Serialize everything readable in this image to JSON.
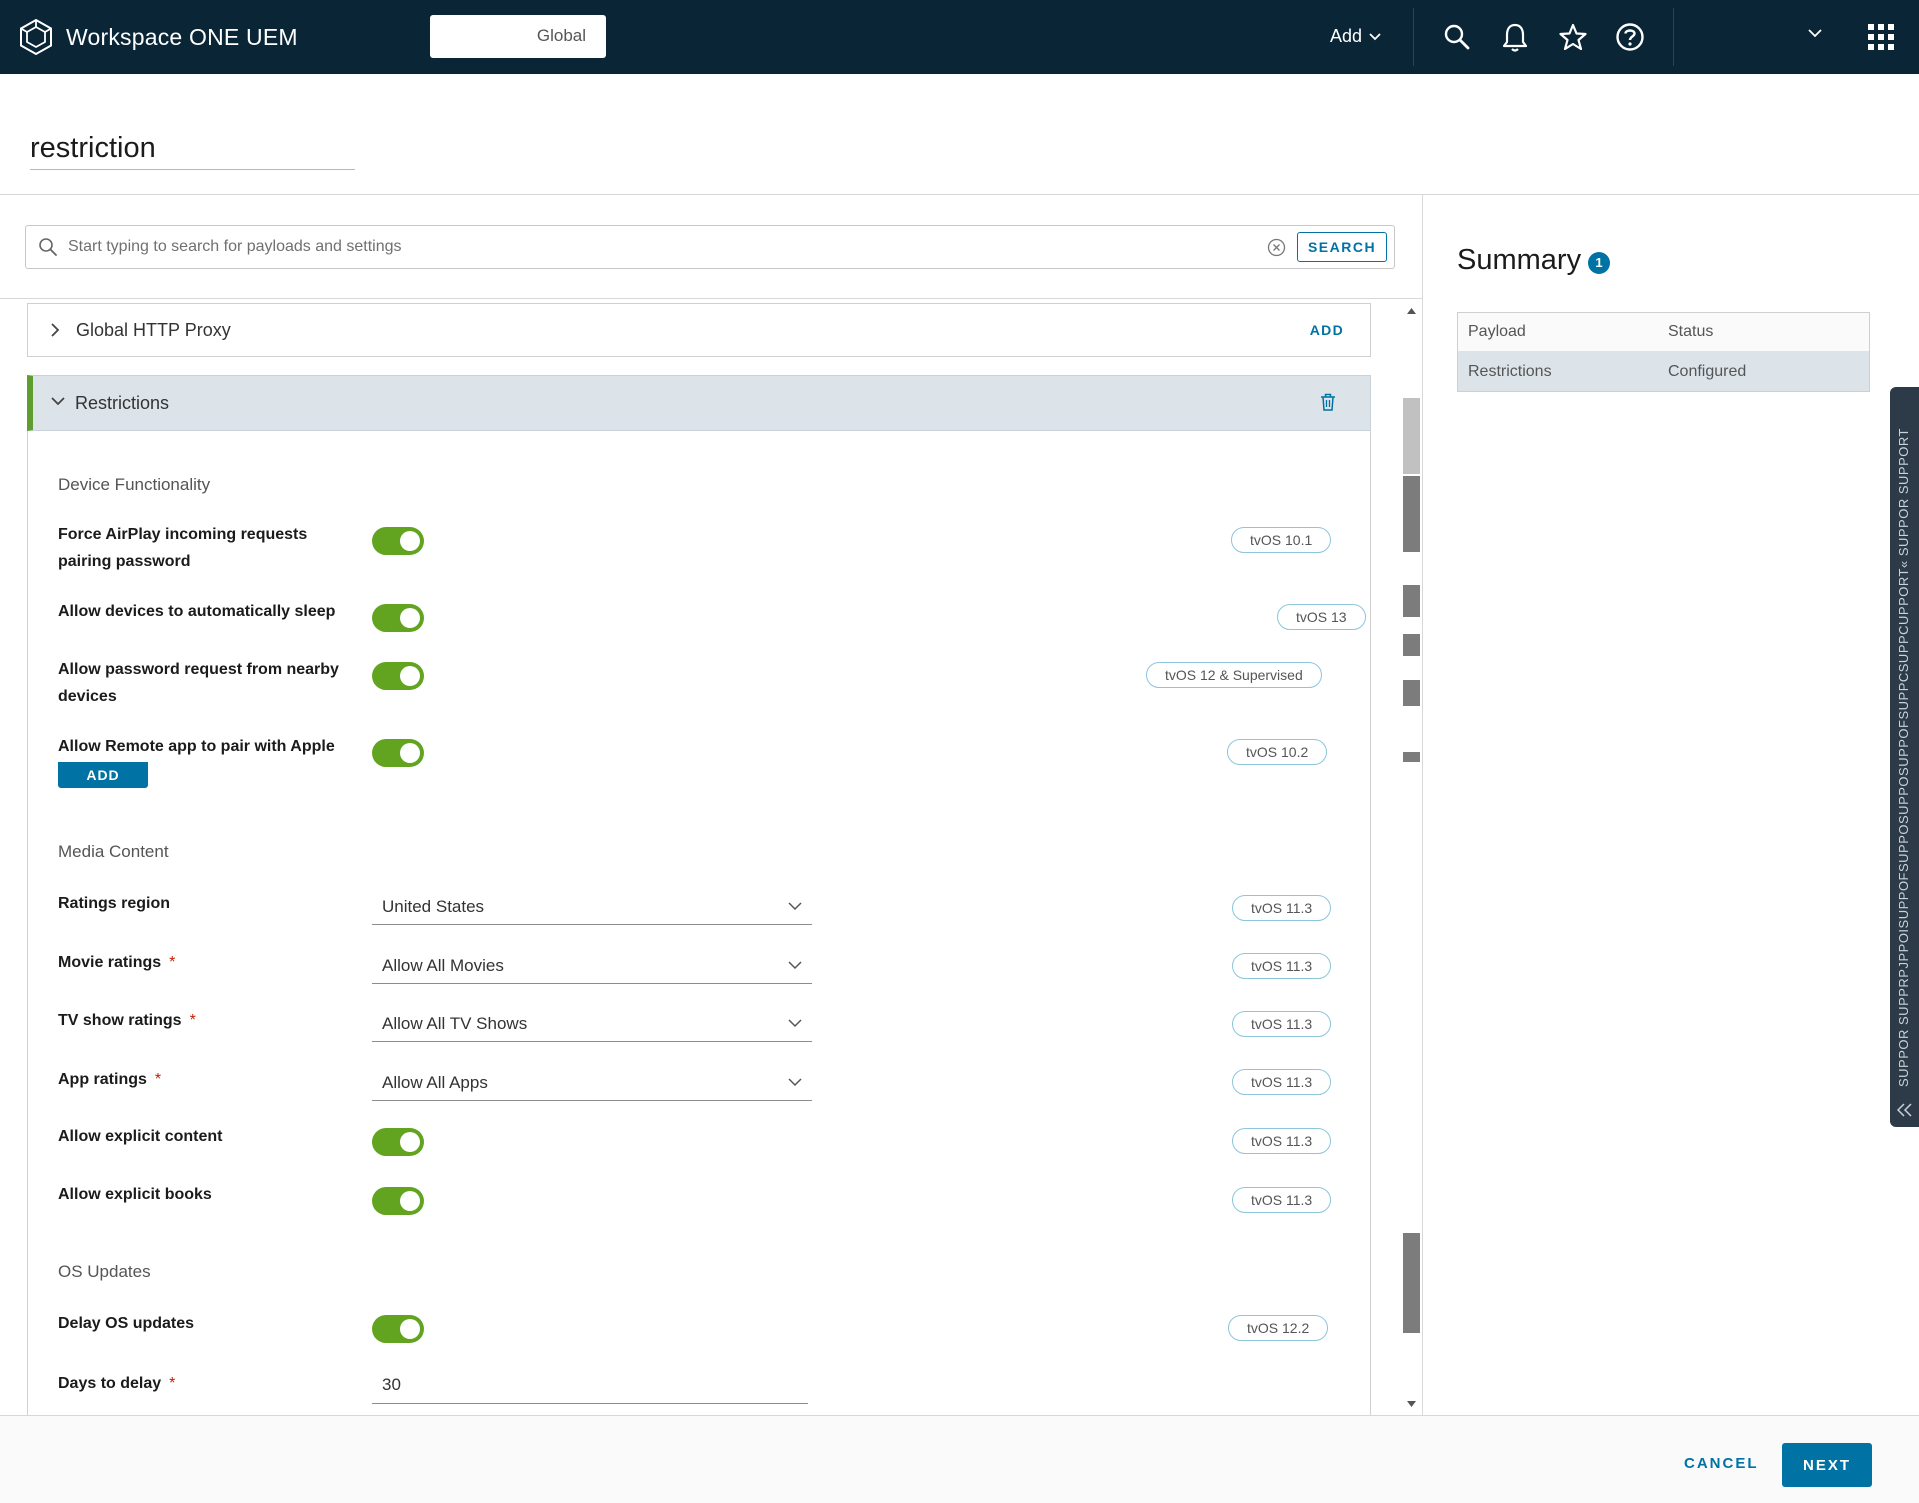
{
  "header": {
    "app_name": "Workspace ONE UEM",
    "org_group": "Global",
    "add_label": "Add",
    "icons": [
      "search-icon",
      "bell-icon",
      "star-icon",
      "help-icon",
      "chevron-down-icon",
      "app-grid-icon"
    ]
  },
  "page": {
    "title": "restriction"
  },
  "search": {
    "placeholder": "Start typing to search for payloads and settings",
    "button_label": "SEARCH"
  },
  "payloads": {
    "proxy": {
      "label": "Global HTTP Proxy",
      "action": "ADD"
    },
    "restrictions": {
      "label": "Restrictions"
    }
  },
  "sections": {
    "device": "Device Functionality",
    "media": "Media Content",
    "os": "OS Updates"
  },
  "fields": {
    "airplay": {
      "label": "Force AirPlay incoming requests pairing password",
      "badge": "tvOS 10.1",
      "on": true
    },
    "sleep": {
      "label": "Allow devices to automatically sleep",
      "badge": "tvOS 13",
      "on": true
    },
    "password": {
      "label": "Allow password request from nearby devices",
      "badge": "tvOS 12 & Supervised",
      "on": true
    },
    "remote": {
      "label": "Allow Remote app to pair with Apple",
      "badge": "tvOS 10.2",
      "on": true,
      "overlay_button": "ADD"
    },
    "ratings_region": {
      "label": "Ratings region",
      "value": "United States",
      "badge": "tvOS 11.3"
    },
    "movie_ratings": {
      "label": "Movie ratings",
      "required": "*",
      "value": "Allow All Movies",
      "badge": "tvOS 11.3"
    },
    "tv_ratings": {
      "label": "TV show ratings",
      "required": "*",
      "value": "Allow All TV Shows",
      "badge": "tvOS 11.3"
    },
    "app_ratings": {
      "label": "App ratings",
      "required": "*",
      "value": "Allow All Apps",
      "badge": "tvOS 11.3"
    },
    "explicit_content": {
      "label": "Allow explicit content",
      "badge": "tvOS 11.3",
      "on": true
    },
    "explicit_books": {
      "label": "Allow explicit books",
      "badge": "tvOS 11.3",
      "on": true
    },
    "delay_updates": {
      "label": "Delay OS updates",
      "badge": "tvOS 12.2",
      "on": true
    },
    "days_delay": {
      "label": "Days to delay",
      "required": "*",
      "value": "30"
    }
  },
  "summary": {
    "title": "Summary",
    "count": "1",
    "columns": [
      "Payload",
      "Status"
    ],
    "rows": [
      {
        "payload": "Restrictions",
        "status": "Configured"
      }
    ]
  },
  "support": {
    "label": "SUPPOR SUPPRPJPPOISUPPOFSUPPOSUPPOSUPPOFSUPPCSUPPCUPPORT« SUPPOR SUPPORT"
  },
  "footer": {
    "cancel": "CANCEL",
    "next": "NEXT"
  },
  "colors": {
    "header_bg": "#0a2536",
    "accent": "#0072a3",
    "toggle_on": "#62a420",
    "selected_row": "#dce4ea",
    "required": "#c21d00"
  }
}
